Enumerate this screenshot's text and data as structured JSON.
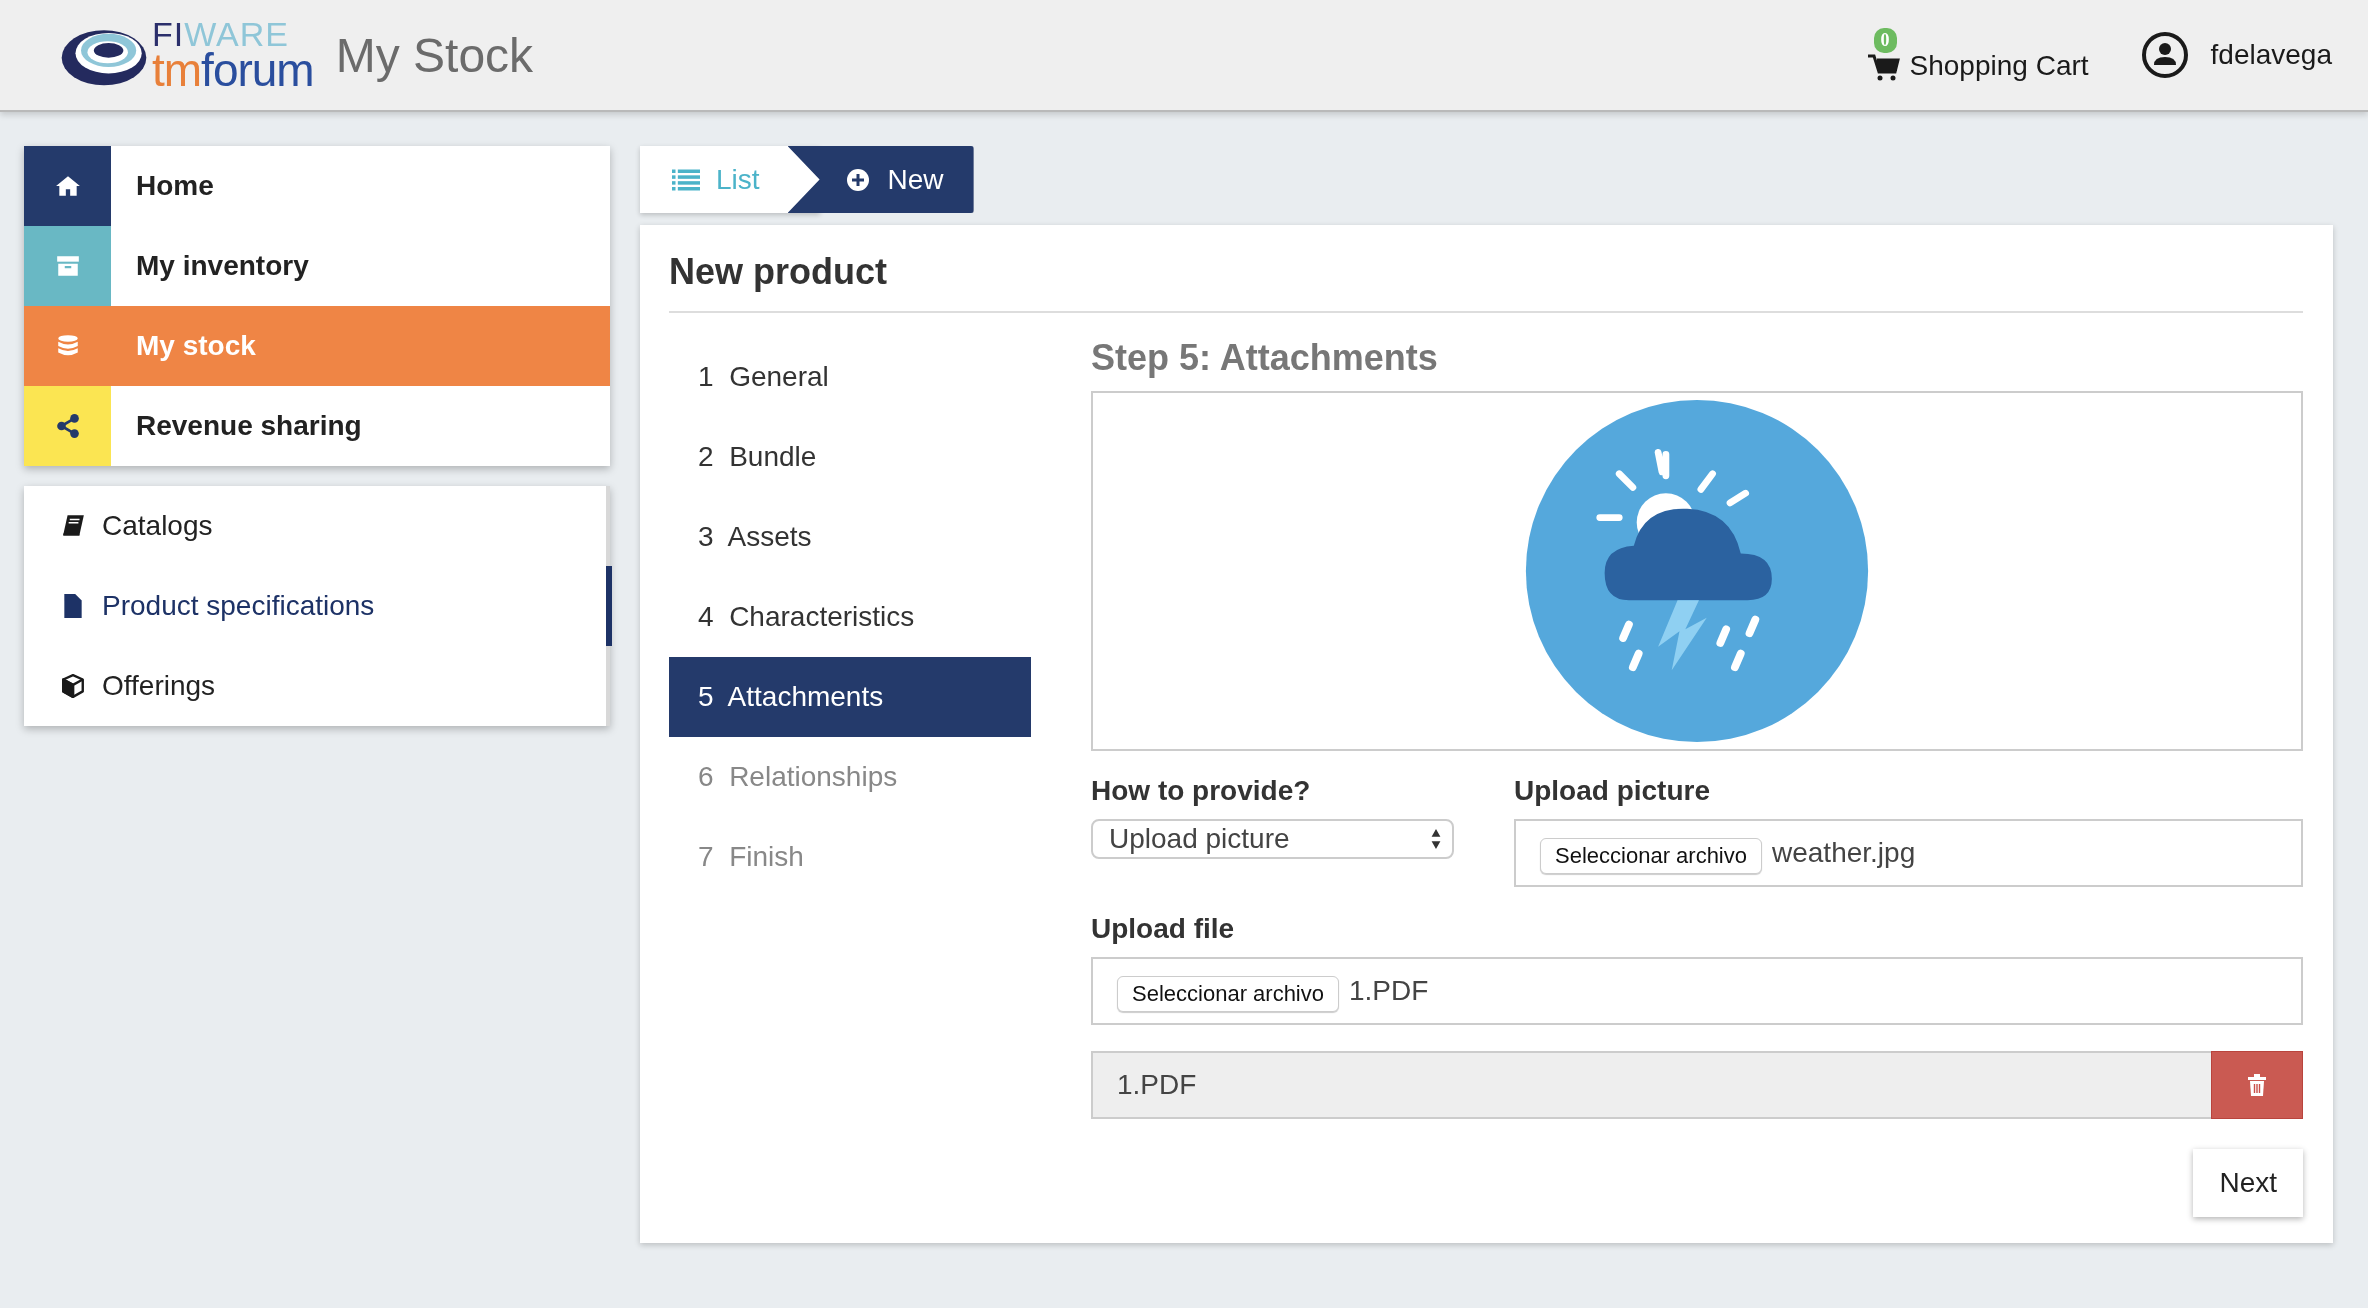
{
  "header": {
    "logo": {
      "upper": [
        {
          "text": "FI",
          "color": "#2b2f6b"
        },
        {
          "text": "WARE",
          "color": "#8fc6d8"
        }
      ],
      "lower": [
        {
          "text": "tm",
          "color": "#e8803a"
        },
        {
          "text": "forum",
          "color": "#2a4e9e"
        }
      ]
    },
    "title": "My Stock",
    "cart": {
      "label": "Shopping Cart",
      "count": "0"
    },
    "user": {
      "name": "fdelavega"
    }
  },
  "main_menu": [
    {
      "label": "Home",
      "kind": "home",
      "color": "#243a6b",
      "selected": false
    },
    {
      "label": "My inventory",
      "kind": "archive",
      "color": "#69b8c4",
      "selected": false
    },
    {
      "label": "My stock",
      "kind": "database",
      "color": "#ef8545",
      "selected": true
    },
    {
      "label": "Revenue sharing",
      "kind": "share",
      "color": "#fbe552",
      "selected": false
    }
  ],
  "sub_menu": [
    {
      "label": "Catalogs",
      "kind": "book",
      "selected": false
    },
    {
      "label": "Product specifications",
      "kind": "file",
      "selected": true
    },
    {
      "label": "Offerings",
      "kind": "cube",
      "selected": false
    }
  ],
  "tabs": [
    {
      "label": "List",
      "kind": "list",
      "selected": false
    },
    {
      "label": "New",
      "kind": "plus",
      "selected": true
    }
  ],
  "card": {
    "title": "New product",
    "steps": [
      {
        "label": "1  General",
        "selected": false,
        "disabled": false
      },
      {
        "label": "2  Bundle",
        "selected": false,
        "disabled": false
      },
      {
        "label": "3  Assets",
        "selected": false,
        "disabled": false
      },
      {
        "label": "4  Characteristics",
        "selected": false,
        "disabled": false
      },
      {
        "label": "5  Attachments",
        "selected": true,
        "disabled": false
      },
      {
        "label": "6  Relationships",
        "selected": false,
        "disabled": true
      },
      {
        "label": "7  Finish",
        "selected": false,
        "disabled": true
      }
    ],
    "step_title": "Step 5: Attachments",
    "how_to_provide": {
      "label": "How to provide?",
      "value": "Upload picture"
    },
    "upload_picture": {
      "label": "Upload picture",
      "button": "Seleccionar archivo",
      "file": "weather.jpg"
    },
    "upload_file": {
      "label": "Upload file",
      "button": "Seleccionar archivo",
      "file": "1.PDF"
    },
    "attachments": [
      {
        "name": "1.PDF"
      }
    ],
    "next_button": "Next"
  }
}
